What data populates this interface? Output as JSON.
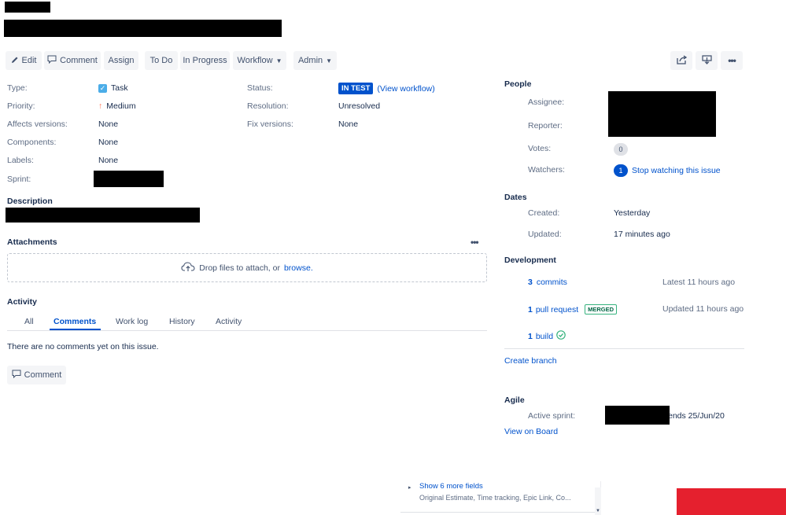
{
  "toolbar": {
    "edit_label": "Edit",
    "comment_label": "Comment",
    "assign_label": "Assign",
    "todo_label": "To Do",
    "in_progress_label": "In Progress",
    "workflow_label": "Workflow",
    "admin_label": "Admin"
  },
  "details": {
    "type_label": "Type:",
    "type_value": "Task",
    "priority_label": "Priority:",
    "priority_value": "Medium",
    "affects_label": "Affects versions:",
    "affects_value": "None",
    "components_label": "Components:",
    "components_value": "None",
    "labels_label": "Labels:",
    "labels_value": "None",
    "sprint_label": "Sprint:",
    "status_label": "Status:",
    "status_value": "IN TEST",
    "view_workflow": "(View workflow)",
    "resolution_label": "Resolution:",
    "resolution_value": "Unresolved",
    "fix_label": "Fix versions:",
    "fix_value": "None"
  },
  "description": {
    "title": "Description"
  },
  "attachments": {
    "title": "Attachments",
    "drop_text": "Drop files to attach, or",
    "browse_text": "browse."
  },
  "activity": {
    "title": "Activity",
    "tabs": [
      "All",
      "Comments",
      "Work log",
      "History",
      "Activity"
    ],
    "active_tab": "Comments",
    "empty_text": "There are no comments yet on this issue.",
    "comment_button": "Comment"
  },
  "people": {
    "title": "People",
    "assignee_label": "Assignee:",
    "reporter_label": "Reporter:",
    "votes_label": "Votes:",
    "votes_count": "0",
    "watchers_label": "Watchers:",
    "watchers_count": "1",
    "stop_watching": "Stop watching this issue"
  },
  "dates": {
    "title": "Dates",
    "created_label": "Created:",
    "created_value": "Yesterday",
    "updated_label": "Updated:",
    "updated_value": "17 minutes ago"
  },
  "development": {
    "title": "Development",
    "commits_count": "3",
    "commits_label": "commits",
    "commits_time": "Latest 11 hours ago",
    "pr_count": "1",
    "pr_label": "pull request",
    "pr_badge": "MERGED",
    "pr_time": "Updated 11 hours ago",
    "build_count": "1",
    "build_label": "build",
    "create_branch": "Create branch"
  },
  "agile": {
    "title": "Agile",
    "active_sprint_label": "Active sprint:",
    "sprint_ends": "ends 25/Jun/20",
    "view_board": "View on Board"
  },
  "footer": {
    "show_more": "Show 6 more fields",
    "fields_hint": "Original Estimate, Time tracking, Epic Link, Co..."
  },
  "colors": {
    "accent": "#0052cc",
    "success": "#36b37e",
    "priority": "#ff7452",
    "red_block": "#e5202e"
  }
}
